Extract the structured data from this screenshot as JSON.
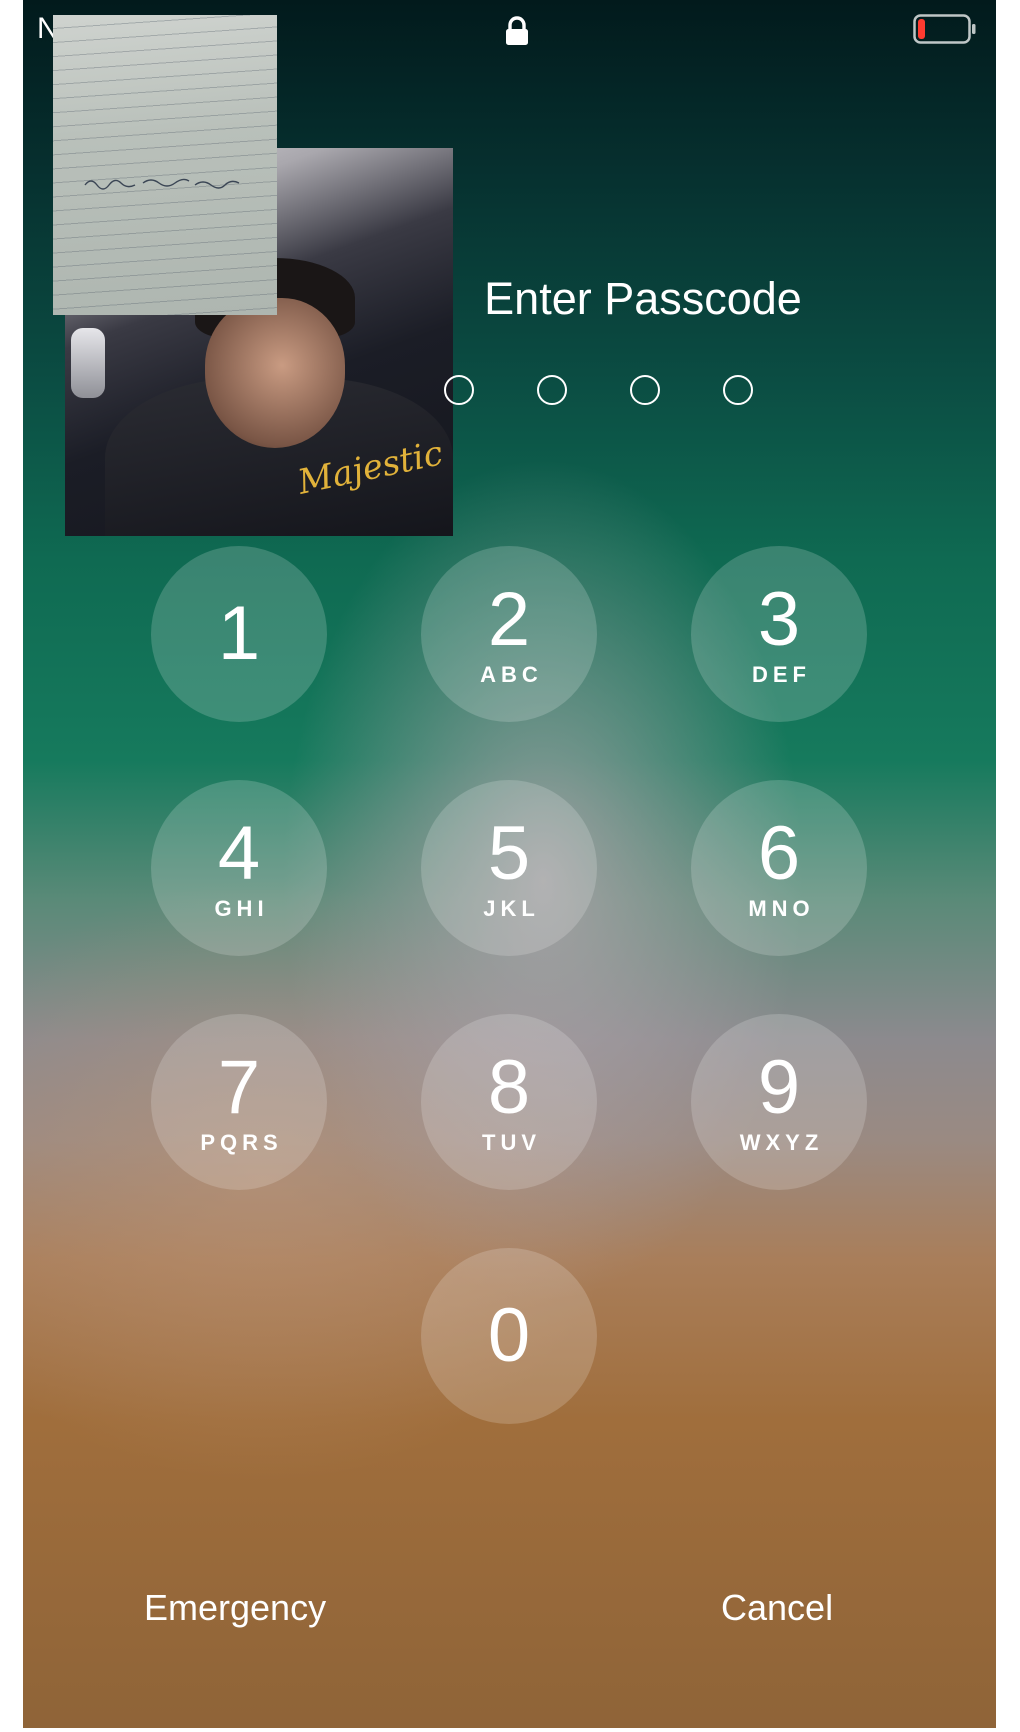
{
  "status_bar": {
    "carrier": "N",
    "lock_icon": "lock-icon",
    "battery_icon": "battery-low-icon",
    "battery_level": 0.12,
    "battery_color": "#ff3b30"
  },
  "overlays": {
    "photo_logo_text": "Majestic"
  },
  "passcode": {
    "title": "Enter Passcode",
    "dot_count": 4,
    "filled": 0
  },
  "keypad": {
    "keys": [
      {
        "digit": "1",
        "letters": ""
      },
      {
        "digit": "2",
        "letters": "ABC"
      },
      {
        "digit": "3",
        "letters": "DEF"
      },
      {
        "digit": "4",
        "letters": "GHI"
      },
      {
        "digit": "5",
        "letters": "JKL"
      },
      {
        "digit": "6",
        "letters": "MNO"
      },
      {
        "digit": "7",
        "letters": "PQRS"
      },
      {
        "digit": "8",
        "letters": "TUV"
      },
      {
        "digit": "9",
        "letters": "WXYZ"
      },
      {
        "digit": "0",
        "letters": ""
      }
    ]
  },
  "footer": {
    "emergency_label": "Emergency",
    "cancel_label": "Cancel"
  }
}
